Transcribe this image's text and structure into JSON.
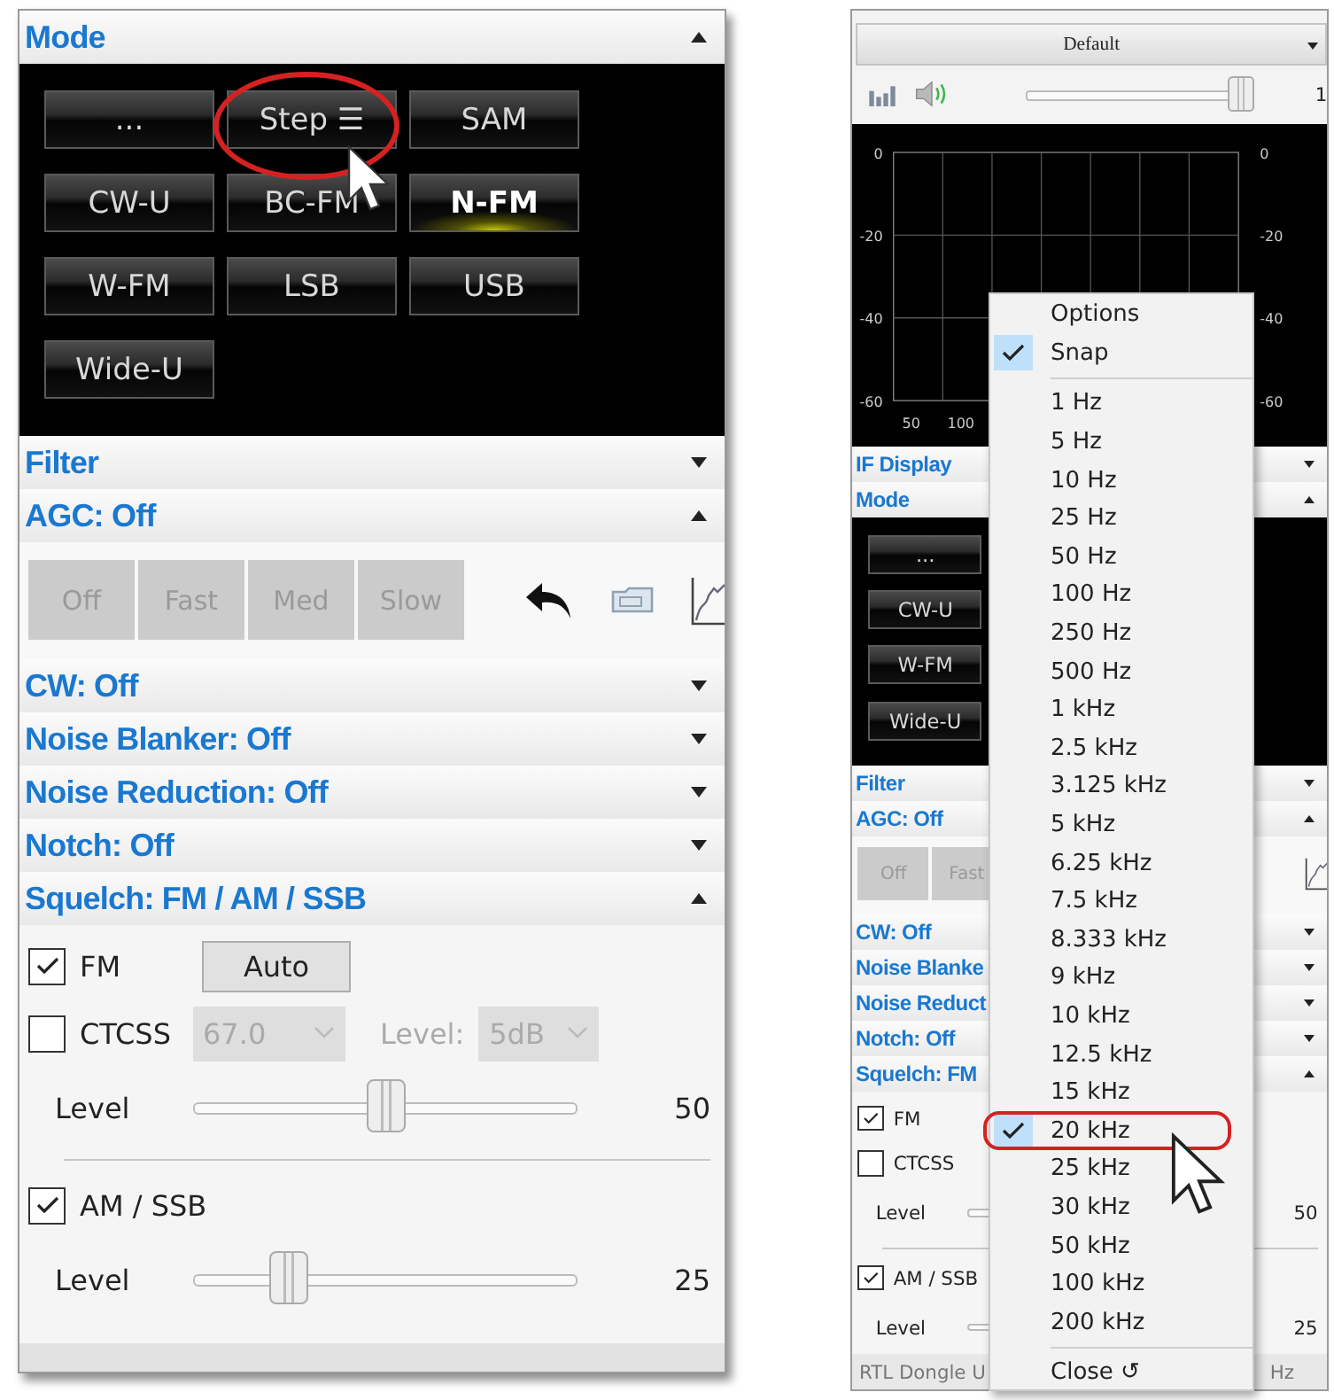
{
  "left_panel": {
    "mode": {
      "title": "Mode",
      "expanded": true,
      "buttons": [
        {
          "label": "...",
          "selected": false
        },
        {
          "label": "Step ☰",
          "selected": false
        },
        {
          "label": "SAM",
          "selected": false
        },
        {
          "label": "CW-U",
          "selected": false
        },
        {
          "label": "BC-FM",
          "selected": false
        },
        {
          "label": "N-FM",
          "selected": true
        },
        {
          "label": "W-FM",
          "selected": false
        },
        {
          "label": "LSB",
          "selected": false
        },
        {
          "label": "USB",
          "selected": false
        },
        {
          "label": "Wide-U",
          "selected": false
        }
      ]
    },
    "filter": {
      "title": "Filter",
      "expanded": false
    },
    "agc": {
      "title": "AGC: Off",
      "expanded": true,
      "buttons": [
        {
          "label": "Off",
          "disabled": true
        },
        {
          "label": "Fast",
          "disabled": true
        },
        {
          "label": "Med",
          "disabled": true
        },
        {
          "label": "Slow",
          "disabled": true
        }
      ],
      "tools": [
        {
          "kind": "undo"
        },
        {
          "kind": "card"
        },
        {
          "kind": "graph"
        }
      ]
    },
    "sections": [
      {
        "title": "CW: Off",
        "expanded": false
      },
      {
        "title": "Noise Blanker: Off",
        "expanded": false
      },
      {
        "title": "Noise Reduction: Off",
        "expanded": false
      },
      {
        "title": "Notch: Off",
        "expanded": false
      },
      {
        "title": "Squelch: FM / AM / SSB",
        "expanded": true
      }
    ],
    "squelch": {
      "fm": {
        "label": "FM",
        "checked": true
      },
      "auto_button": "Auto",
      "ctcss": {
        "label": "CTCSS",
        "checked": false
      },
      "tone_select": {
        "value": "67.0",
        "disabled": true
      },
      "tone_level_label": "Level:",
      "tone_level_select": {
        "value": "5dB",
        "disabled": true
      },
      "fm_level": {
        "label": "Level",
        "level": 0.5,
        "reading": "50"
      },
      "am_ssb": {
        "label": "AM / SSB",
        "checked": true
      },
      "am_level": {
        "label": "Level",
        "level": 0.25,
        "reading": "25"
      }
    }
  },
  "right_panel": {
    "preset": "Default",
    "volume": {
      "level": 0.97,
      "reading": "1"
    },
    "display": {
      "left_ticks": [
        "0",
        "-20",
        "-40",
        "-60"
      ],
      "right_ticks": [
        "0",
        "-20",
        "-40",
        "-60"
      ],
      "x_ticks": [
        "50",
        "100"
      ]
    },
    "if_display": {
      "title": "IF Display",
      "expanded": false
    },
    "mode": {
      "title": "Mode",
      "expanded": true,
      "buttons": [
        {
          "label": "...",
          "selected": false
        },
        {
          "label": "CW-U",
          "selected": false
        },
        {
          "label": "W-FM",
          "selected": false
        },
        {
          "label": "Wide-U",
          "selected": false
        }
      ]
    },
    "filter": {
      "title": "Filter",
      "expanded": false
    },
    "agc": {
      "title": "AGC: Off",
      "expanded": true,
      "buttons": [
        {
          "label": "Off",
          "disabled": true
        },
        {
          "label": "Fast",
          "disabled": true
        }
      ],
      "tools": [
        {
          "kind": "graph"
        }
      ]
    },
    "sections": [
      {
        "title": "CW: Off",
        "expanded": false
      },
      {
        "title": "Noise Blanke",
        "expanded": false
      },
      {
        "title": "Noise Reduct",
        "expanded": false
      },
      {
        "title": "Notch: Off",
        "expanded": false
      },
      {
        "title": "Squelch: FM",
        "expanded": true
      }
    ],
    "squelch": {
      "fm": {
        "label": "FM",
        "checked": true
      },
      "ctcss": {
        "label": "CTCSS",
        "checked": false
      },
      "fm_level": {
        "label": "Level",
        "reading": "50"
      },
      "am_ssb": {
        "label": "AM / SSB",
        "checked": true
      },
      "am_level": {
        "label": "Level",
        "reading": "25"
      }
    },
    "status": {
      "left": "RTL Dongle U",
      "right": "Hz"
    }
  },
  "step_menu": {
    "items": [
      {
        "kind": "header",
        "label": "Options"
      },
      {
        "kind": "toggle",
        "label": "Snap",
        "checked": true
      },
      {
        "kind": "separator"
      },
      {
        "kind": "step",
        "label": "1 Hz",
        "selected": false
      },
      {
        "kind": "step",
        "label": "5 Hz",
        "selected": false
      },
      {
        "kind": "step",
        "label": "10 Hz",
        "selected": false
      },
      {
        "kind": "step",
        "label": "25 Hz",
        "selected": false
      },
      {
        "kind": "step",
        "label": "50 Hz",
        "selected": false
      },
      {
        "kind": "step",
        "label": "100 Hz",
        "selected": false
      },
      {
        "kind": "step",
        "label": "250 Hz",
        "selected": false
      },
      {
        "kind": "step",
        "label": "500 Hz",
        "selected": false
      },
      {
        "kind": "step",
        "label": "1 kHz",
        "selected": false
      },
      {
        "kind": "step",
        "label": "2.5 kHz",
        "selected": false
      },
      {
        "kind": "step",
        "label": "3.125 kHz",
        "selected": false
      },
      {
        "kind": "step",
        "label": "5 kHz",
        "selected": false
      },
      {
        "kind": "step",
        "label": "6.25 kHz",
        "selected": false
      },
      {
        "kind": "step",
        "label": "7.5 kHz",
        "selected": false
      },
      {
        "kind": "step",
        "label": "8.333 kHz",
        "selected": false
      },
      {
        "kind": "step",
        "label": "9 kHz",
        "selected": false
      },
      {
        "kind": "step",
        "label": "10 kHz",
        "selected": false
      },
      {
        "kind": "step",
        "label": "12.5 kHz",
        "selected": false
      },
      {
        "kind": "step",
        "label": "15 kHz",
        "selected": false
      },
      {
        "kind": "step",
        "label": "20 kHz",
        "selected": true
      },
      {
        "kind": "step",
        "label": "25 kHz",
        "selected": false
      },
      {
        "kind": "step",
        "label": "30 kHz",
        "selected": false
      },
      {
        "kind": "step",
        "label": "50 kHz",
        "selected": false
      },
      {
        "kind": "step",
        "label": "100 kHz",
        "selected": false
      },
      {
        "kind": "step",
        "label": "200 kHz",
        "selected": false
      },
      {
        "kind": "separator"
      },
      {
        "kind": "close",
        "label": "Close ↺"
      }
    ]
  }
}
